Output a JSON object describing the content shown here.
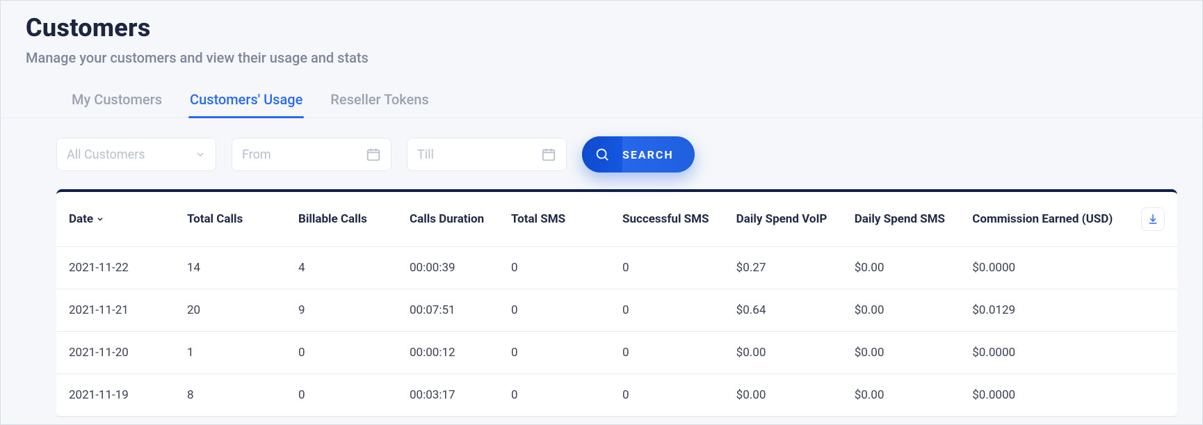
{
  "header": {
    "title": "Customers",
    "subtitle": "Manage your customers and view their usage and stats"
  },
  "tabs": {
    "items": [
      {
        "label": "My Customers",
        "active": false
      },
      {
        "label": "Customers' Usage",
        "active": true
      },
      {
        "label": "Reseller Tokens",
        "active": false
      }
    ]
  },
  "filters": {
    "customer_select": {
      "value": "All Customers"
    },
    "from": {
      "placeholder": "From",
      "value": ""
    },
    "till": {
      "placeholder": "Till",
      "value": ""
    },
    "search_label": "SEARCH"
  },
  "table": {
    "columns": [
      "Date",
      "Total Calls",
      "Billable Calls",
      "Calls Duration",
      "Total SMS",
      "Successful SMS",
      "Daily Spend VoIP",
      "Daily Spend SMS",
      "Commission Earned (USD)"
    ],
    "rows": [
      {
        "date": "2021-11-22",
        "total_calls": "14",
        "billable": "4",
        "duration": "00:00:39",
        "total_sms": "0",
        "success_sms": "0",
        "voip": "$0.27",
        "sms": "$0.00",
        "commission": "$0.0000"
      },
      {
        "date": "2021-11-21",
        "total_calls": "20",
        "billable": "9",
        "duration": "00:07:51",
        "total_sms": "0",
        "success_sms": "0",
        "voip": "$0.64",
        "sms": "$0.00",
        "commission": "$0.0129"
      },
      {
        "date": "2021-11-20",
        "total_calls": "1",
        "billable": "0",
        "duration": "00:00:12",
        "total_sms": "0",
        "success_sms": "0",
        "voip": "$0.00",
        "sms": "$0.00",
        "commission": "$0.0000"
      },
      {
        "date": "2021-11-19",
        "total_calls": "8",
        "billable": "0",
        "duration": "00:03:17",
        "total_sms": "0",
        "success_sms": "0",
        "voip": "$0.00",
        "sms": "$0.00",
        "commission": "$0.0000"
      }
    ]
  }
}
